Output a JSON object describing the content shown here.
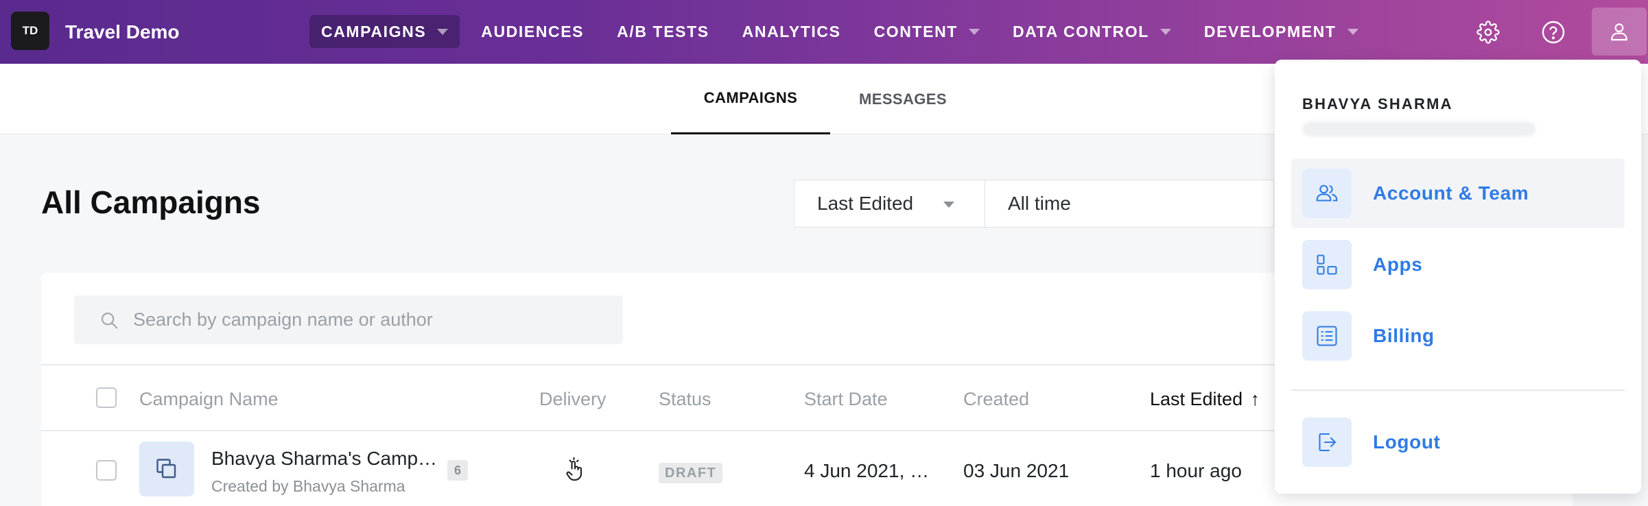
{
  "app": {
    "logo_initials": "TD",
    "title": "Travel Demo"
  },
  "nav": {
    "items": [
      {
        "label": "CAMPAIGNS",
        "dropdown": true,
        "active": true
      },
      {
        "label": "AUDIENCES",
        "dropdown": false
      },
      {
        "label": "A/B TESTS",
        "dropdown": false
      },
      {
        "label": "ANALYTICS",
        "dropdown": false
      },
      {
        "label": "CONTENT",
        "dropdown": true
      },
      {
        "label": "DATA CONTROL",
        "dropdown": true
      },
      {
        "label": "DEVELOPMENT",
        "dropdown": true
      }
    ],
    "icons": [
      "gear-icon",
      "help-icon",
      "user-icon"
    ]
  },
  "subtabs": [
    {
      "label": "CAMPAIGNS",
      "active": true
    },
    {
      "label": "MESSAGES",
      "active": false
    }
  ],
  "page": {
    "title": "All Campaigns",
    "filter": {
      "field": "Last Edited",
      "range": "All time"
    },
    "search": {
      "placeholder": "Search by campaign name or author"
    }
  },
  "table": {
    "columns": [
      "Campaign Name",
      "Delivery",
      "Status",
      "Start Date",
      "Created",
      "Last Edited"
    ],
    "sorted_column": "Last Edited",
    "sort_direction": "ascending",
    "rows": [
      {
        "name": "Bhavya Sharma's Camp…",
        "author": "Created by Bhavya Sharma",
        "count": "6",
        "status": "DRAFT",
        "start_date": "4 Jun 2021, …",
        "created": "03 Jun 2021",
        "last_edited": "1 hour ago"
      }
    ]
  },
  "profile_menu": {
    "user_name": "BHAVYA SHARMA",
    "items": [
      {
        "label": "Account & Team",
        "icon": "users-icon"
      },
      {
        "label": "Apps",
        "icon": "apps-icon"
      },
      {
        "label": "Billing",
        "icon": "billing-icon"
      },
      {
        "label": "Logout",
        "icon": "logout-icon"
      }
    ]
  },
  "colors": {
    "nav_gradient_start": "#5a2a8e",
    "nav_gradient_end": "#b14b9d",
    "link_blue": "#2f7be5",
    "icon_tile": "#e3edfb"
  }
}
